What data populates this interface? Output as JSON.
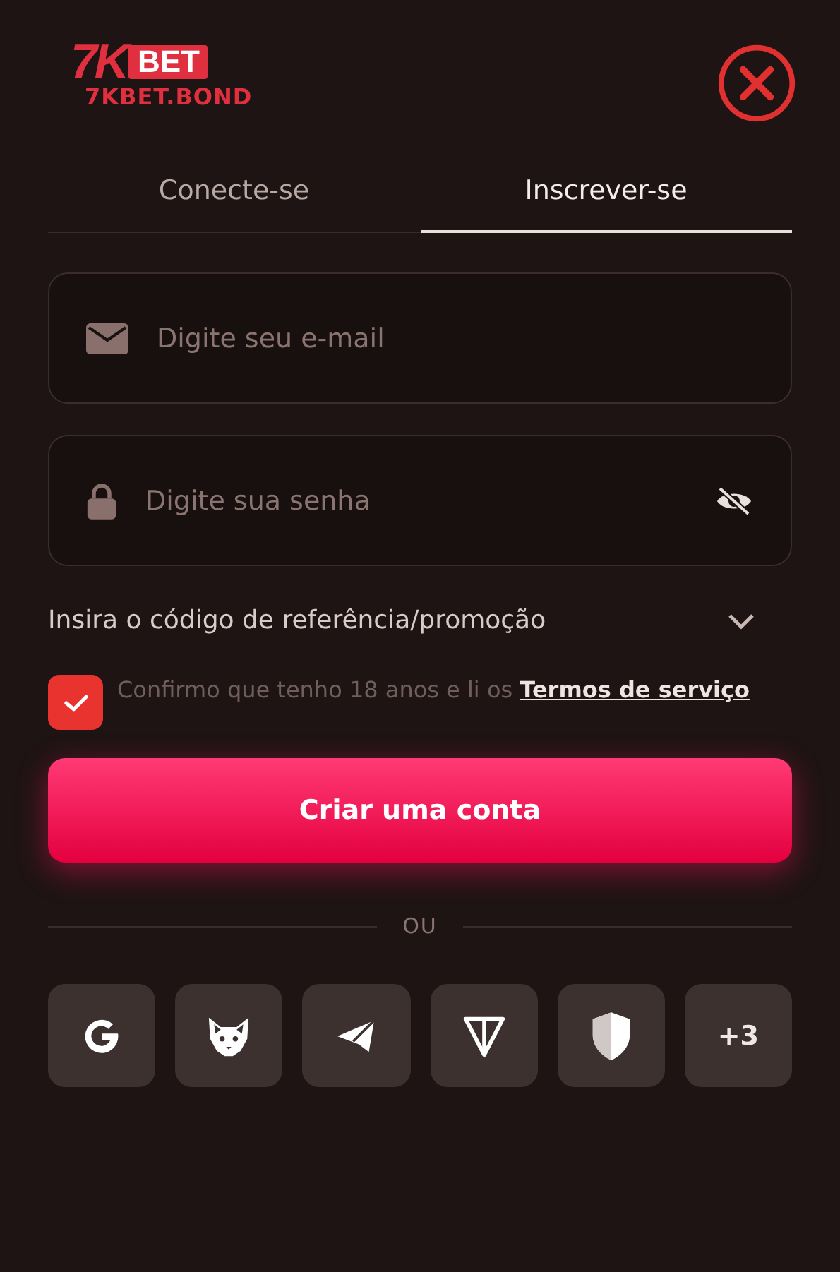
{
  "logo": {
    "mark": "7K",
    "badge": "BET",
    "domain": "7KBET.BOND"
  },
  "tabs": [
    {
      "label": "Conecte-se",
      "selected": false
    },
    {
      "label": "Inscrever-se",
      "selected": true
    }
  ],
  "fields": [
    {
      "kind": "email",
      "placeholder": "Digite seu e-mail"
    },
    {
      "kind": "password",
      "placeholder": "Digite sua senha"
    }
  ],
  "referral": {
    "label": "Insira o código de referência/promoção",
    "expanded": false
  },
  "terms": {
    "checked": true,
    "text": "Confirmo que tenho 18 anos e li os",
    "link": "Termos de serviço"
  },
  "submit": "Criar uma conta",
  "divider": "OU",
  "social": [
    {
      "kind": "google"
    },
    {
      "kind": "fox"
    },
    {
      "kind": "telegram"
    },
    {
      "kind": "ton"
    },
    {
      "kind": "shield"
    },
    {
      "kind": "more",
      "label": "+3"
    }
  ]
}
